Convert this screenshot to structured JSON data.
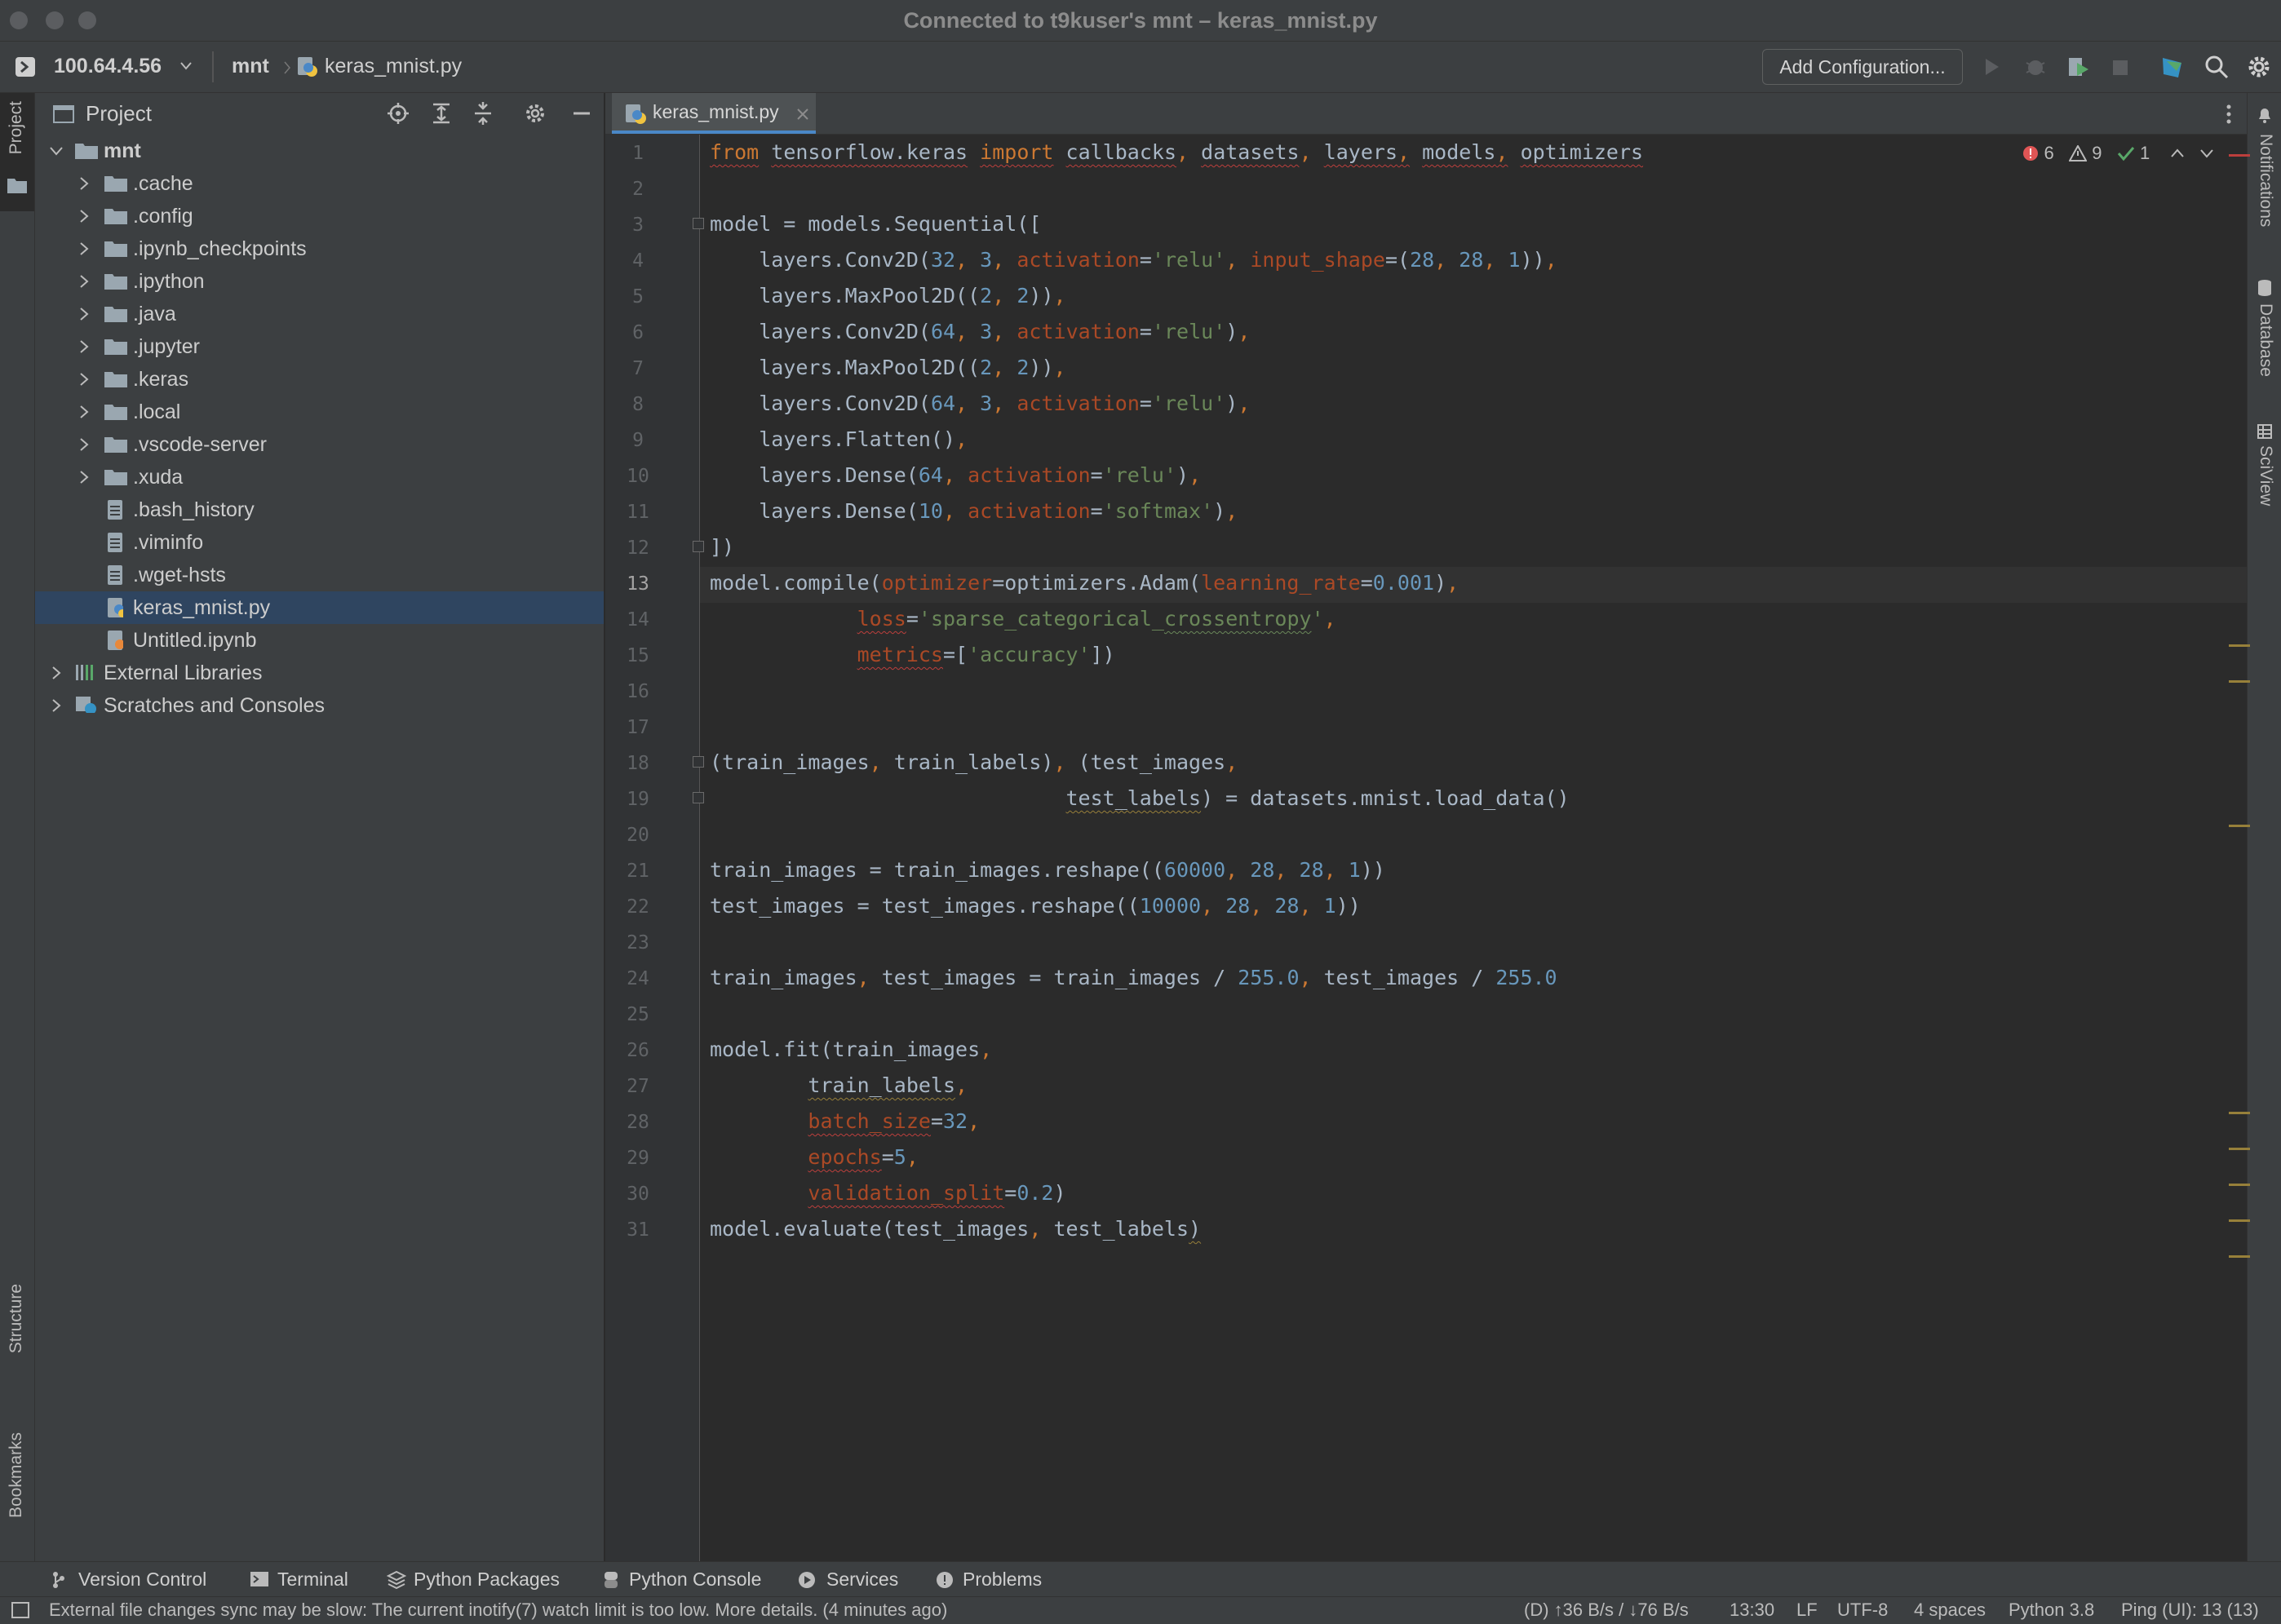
{
  "window": {
    "title": "Connected to t9kuser's mnt – keras_mnist.py"
  },
  "navbar": {
    "host": "100.64.4.56",
    "crumb_project": "mnt",
    "crumb_file": "keras_mnist.py",
    "add_configuration": "Add Configuration..."
  },
  "left_stripe": {
    "project": "Project",
    "structure": "Structure",
    "bookmarks": "Bookmarks"
  },
  "right_stripe": {
    "notifications": "Notifications",
    "database": "Database",
    "sciview": "SciView"
  },
  "project_panel": {
    "title": "Project",
    "root": "mnt",
    "folders": [
      ".cache",
      ".config",
      ".ipynb_checkpoints",
      ".ipython",
      ".java",
      ".jupyter",
      ".keras",
      ".local",
      ".vscode-server",
      ".xuda"
    ],
    "files": [
      ".bash_history",
      ".viminfo",
      ".wget-hsts",
      "keras_mnist.py",
      "Untitled.ipynb"
    ],
    "selected_file": "keras_mnist.py",
    "extra": [
      "External Libraries",
      "Scratches and Consoles"
    ]
  },
  "editor": {
    "tab": "keras_mnist.py",
    "inspections": {
      "errors": "6",
      "warnings": "9",
      "ok": "1"
    },
    "current_line": 13,
    "line_numbers": [
      "1",
      "2",
      "3",
      "4",
      "5",
      "6",
      "7",
      "8",
      "9",
      "10",
      "11",
      "12",
      "13",
      "14",
      "15",
      "16",
      "17",
      "18",
      "19",
      "20",
      "21",
      "22",
      "23",
      "24",
      "25",
      "26",
      "27",
      "28",
      "29",
      "30",
      "31"
    ]
  },
  "tool_windows": [
    "Version Control",
    "Terminal",
    "Python Packages",
    "Python Console",
    "Services",
    "Problems"
  ],
  "status": {
    "message": "External file changes sync may be slow: The current inotify(7) watch limit is too low. More details. (4 minutes ago)",
    "transfer": "(D) ↑36 B/s / ↓76 B/s",
    "position": "13:30",
    "line_sep": "LF",
    "encoding": "UTF-8",
    "indent": "4 spaces",
    "interpreter": "Python 3.8",
    "ping": "Ping (UI): 13 (13)"
  },
  "colors": {
    "accent": "#4a88c7",
    "selection": "#2f4560",
    "keyword": "#cc7832",
    "string": "#6a8759",
    "number": "#6897bb",
    "param": "#aa4926"
  }
}
